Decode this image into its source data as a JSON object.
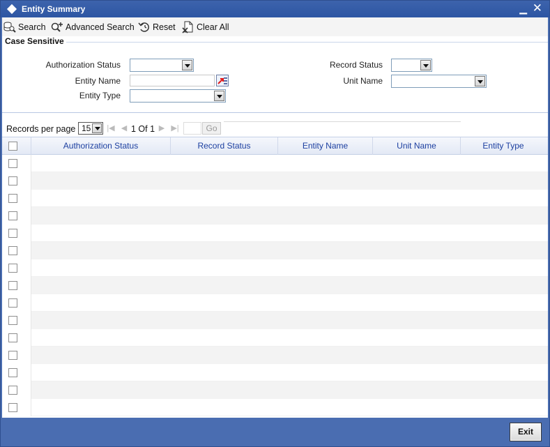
{
  "window": {
    "title": "Entity Summary",
    "minimize_glyph": "▁",
    "close_glyph": "✕"
  },
  "toolbar": {
    "search_label": "Search",
    "advanced_search_label": "Advanced Search",
    "reset_label": "Reset",
    "clear_all_label": "Clear All"
  },
  "form": {
    "section_title": "Case Sensitive",
    "authorization_status_label": "Authorization Status",
    "entity_name_label": "Entity Name",
    "entity_type_label": "Entity Type",
    "record_status_label": "Record Status",
    "unit_name_label": "Unit Name",
    "authorization_status_value": "",
    "entity_name_value": "",
    "entity_type_value": "",
    "record_status_value": "",
    "unit_name_value": ""
  },
  "pager": {
    "records_per_page_label": "Records per page",
    "records_per_page_value": "15",
    "page_position": "1 Of 1",
    "go_label": "Go"
  },
  "grid": {
    "columns": [
      "Authorization Status",
      "Record Status",
      "Entity Name",
      "Unit Name",
      "Entity Type"
    ],
    "row_count": 15
  },
  "footer": {
    "exit_label": "Exit"
  },
  "colors": {
    "frame": "#4a6db1",
    "header_text": "#1c3fa0"
  }
}
